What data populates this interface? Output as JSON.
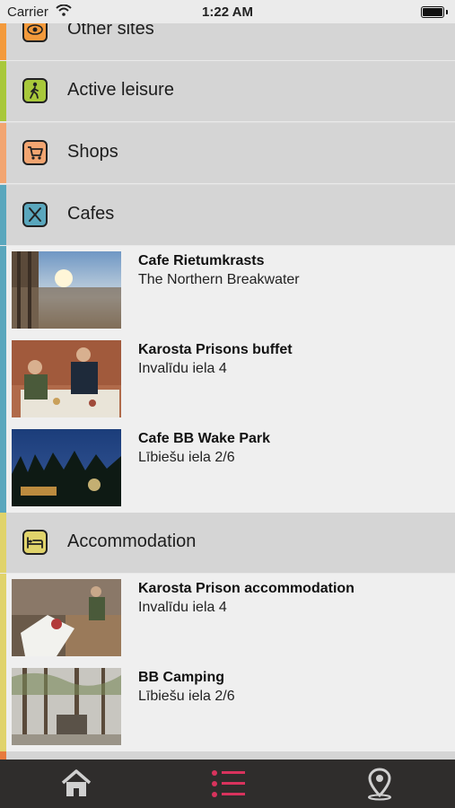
{
  "status_bar": {
    "carrier": "Carrier",
    "time": "1:22 AM"
  },
  "categories": [
    {
      "label": "Other sites",
      "icon": "eye-icon",
      "color": "#f39a3c"
    },
    {
      "label": "Active leisure",
      "icon": "hiker-icon",
      "color": "#a8c83a"
    },
    {
      "label": "Shops",
      "icon": "cart-icon",
      "color": "#f2a571"
    },
    {
      "label": "Cafes",
      "icon": "cutlery-icon",
      "color": "#5aa7bd"
    },
    {
      "label": "Accommodation",
      "icon": "bed-icon",
      "color": "#e0d36b"
    }
  ],
  "cafes": [
    {
      "name": "Cafe Rietumkrasts",
      "address": "The Northern Breakwater"
    },
    {
      "name": "Karosta Prisons buffet",
      "address": "Invalīdu iela 4"
    },
    {
      "name": "Cafe BB Wake Park",
      "address": "Lībiešu iela 2/6"
    }
  ],
  "accommodation": [
    {
      "name": "Karosta Prison accommodation",
      "address": "Invalīdu iela 4"
    },
    {
      "name": "BB Camping",
      "address": "Lībiešu iela 2/6"
    }
  ],
  "tab_bar": {
    "tabs": [
      {
        "icon": "home-icon",
        "active": false
      },
      {
        "icon": "list-icon",
        "active": true
      },
      {
        "icon": "map-pin-icon",
        "active": false
      }
    ],
    "active_color": "#d8335d",
    "inactive_color": "#d0d0d0"
  }
}
